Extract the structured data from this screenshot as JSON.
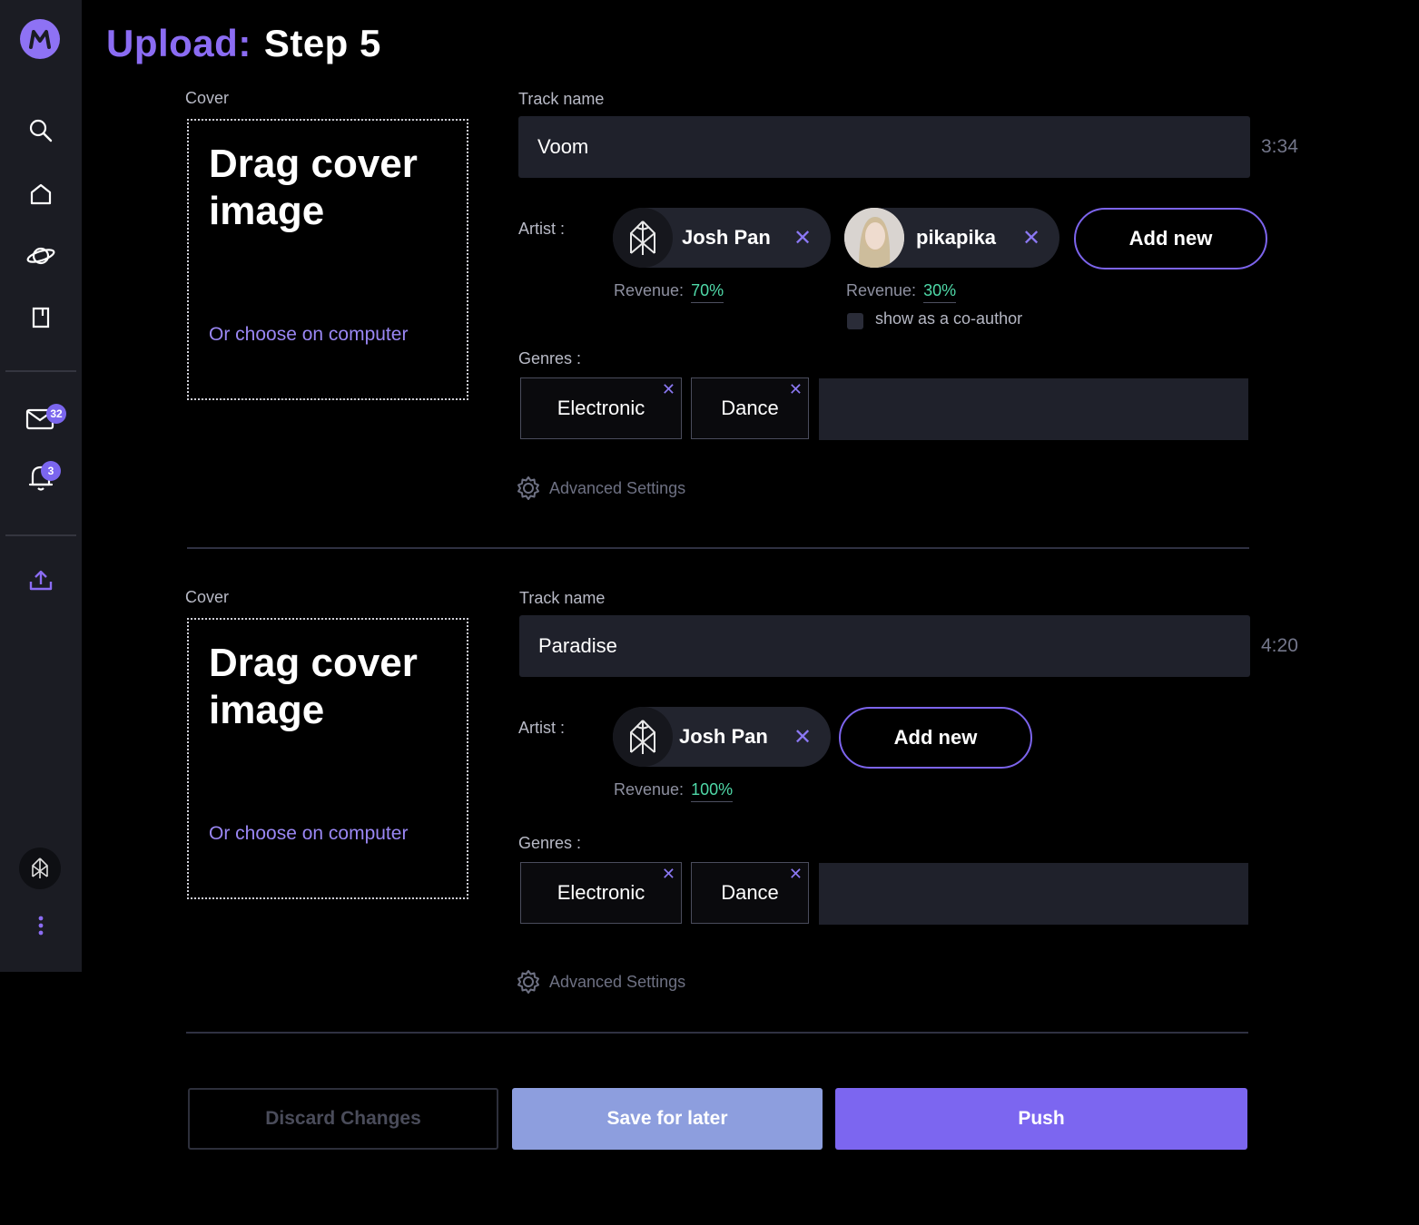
{
  "sidebar": {
    "mail_badge": "32",
    "notif_badge": "3"
  },
  "page": {
    "title_accent": "Upload:",
    "title_step": "Step 5"
  },
  "tracks": [
    {
      "cover_label": "Cover",
      "cover_drop_text": "Drag cover image",
      "cover_choose_text": "Or choose on computer",
      "track_name_label": "Track name",
      "track_name": "Voom",
      "duration": "3:34",
      "artist_label": "Artist :",
      "artists": [
        {
          "name": "Josh Pan",
          "revenue_label": "Revenue:",
          "revenue": "70%"
        },
        {
          "name": "pikapika",
          "revenue_label": "Revenue:",
          "revenue": "30%"
        }
      ],
      "coauthor_label": "show as a co-author",
      "add_new_label": "Add new",
      "genres_label": "Genres :",
      "genres": [
        "Electronic",
        "Dance"
      ],
      "advanced_label": "Advanced Settings"
    },
    {
      "cover_label": "Cover",
      "cover_drop_text": "Drag cover image",
      "cover_choose_text": "Or choose on computer",
      "track_name_label": "Track name",
      "track_name": "Paradise",
      "duration": "4:20",
      "artist_label": "Artist :",
      "artists": [
        {
          "name": "Josh Pan",
          "revenue_label": "Revenue:",
          "revenue": "100%"
        }
      ],
      "add_new_label": "Add new",
      "genres_label": "Genres :",
      "genres": [
        "Electronic",
        "Dance"
      ],
      "advanced_label": "Advanced Settings"
    }
  ],
  "actions": {
    "discard": "Discard Changes",
    "save": "Save for later",
    "push": "Push"
  },
  "colors": {
    "accent": "#7c66f0",
    "revenue": "#4fd9a8",
    "sidebar_bg": "#1b1c23",
    "input_bg": "#1f212b"
  }
}
